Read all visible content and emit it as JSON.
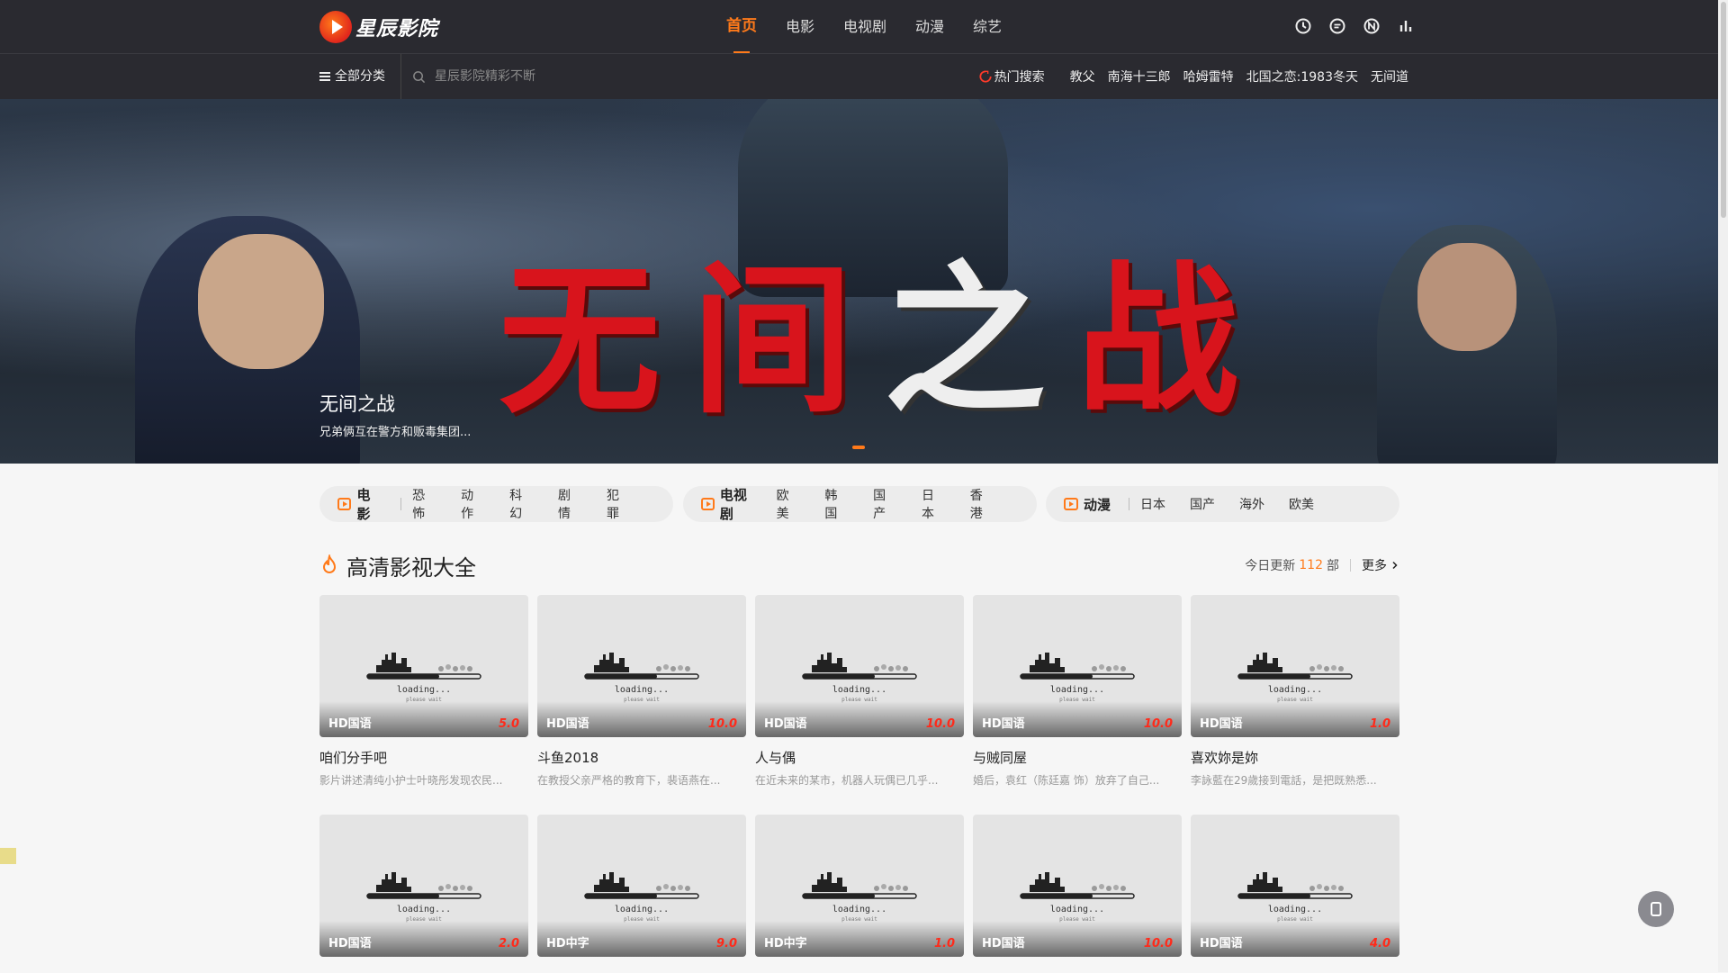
{
  "header": {
    "logo_text": "星辰影院",
    "nav": [
      {
        "label": "首页",
        "active": true
      },
      {
        "label": "电影",
        "active": false
      },
      {
        "label": "电视剧",
        "active": false
      },
      {
        "label": "动漫",
        "active": false
      },
      {
        "label": "综艺",
        "active": false
      }
    ],
    "icons": [
      "clock-icon",
      "message-icon",
      "n-circle-icon",
      "chart-icon"
    ]
  },
  "subbar": {
    "all_categories": "全部分类",
    "search_placeholder": "星辰影院精彩不断",
    "hot_label": "热门搜索",
    "hot_keywords": [
      "教父",
      "南海十三郎",
      "哈姆雷特",
      "北国之恋:1983冬天",
      "无间道"
    ]
  },
  "banner": {
    "title_art": [
      "无",
      "间",
      "之",
      "战"
    ],
    "caption_title": "无间之战",
    "caption_desc": "兄弟俩互在警方和贩毒集团..."
  },
  "categories": [
    {
      "head": "电影",
      "subs": [
        "恐怖",
        "动作",
        "科幻",
        "剧情",
        "犯罪"
      ]
    },
    {
      "head": "电视剧",
      "subs": [
        "欧美",
        "韩国",
        "国产",
        "日本",
        "香港"
      ]
    },
    {
      "head": "动漫",
      "subs": [
        "日本",
        "国产",
        "海外",
        "欧美"
      ]
    }
  ],
  "section": {
    "title": "高清影视大全",
    "today_prefix": "今日更新",
    "today_count": "112",
    "today_suffix": "部",
    "more": "更多"
  },
  "placeholder": {
    "loading": "loading...",
    "wait": "please wait"
  },
  "movies": [
    {
      "tag": "HD国语",
      "score": "5.0",
      "name": "咱们分手吧",
      "desc": "影片讲述清纯小护士叶晓彤发现农民..."
    },
    {
      "tag": "HD国语",
      "score": "10.0",
      "name": "斗鱼2018",
      "desc": "在教授父亲严格的教育下，裴语燕在..."
    },
    {
      "tag": "HD国语",
      "score": "10.0",
      "name": "人与偶",
      "desc": "在近未来的某市，机器人玩偶已几乎..."
    },
    {
      "tag": "HD国语",
      "score": "10.0",
      "name": "与贼同屋",
      "desc": "婚后，袁红（陈廷嘉 饰）放弃了自己..."
    },
    {
      "tag": "HD国语",
      "score": "1.0",
      "name": "喜欢妳是妳",
      "desc": "李詠藍在29歲接到電話，是把既熟悉..."
    },
    {
      "tag": "HD国语",
      "score": "2.0",
      "name": "",
      "desc": ""
    },
    {
      "tag": "HD中字",
      "score": "9.0",
      "name": "",
      "desc": ""
    },
    {
      "tag": "HD中字",
      "score": "1.0",
      "name": "",
      "desc": ""
    },
    {
      "tag": "HD国语",
      "score": "10.0",
      "name": "",
      "desc": ""
    },
    {
      "tag": "HD国语",
      "score": "4.0",
      "name": "",
      "desc": ""
    }
  ]
}
